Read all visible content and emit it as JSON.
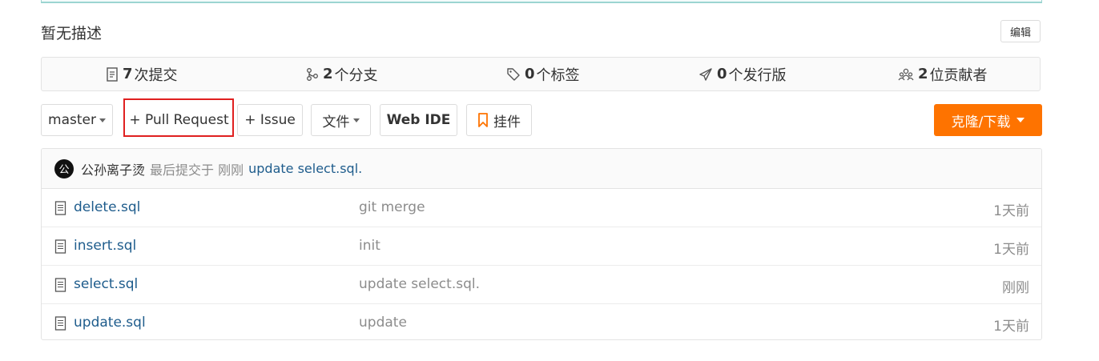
{
  "repo": {
    "description": "暂无描述",
    "edit_label": "编辑"
  },
  "stats": [
    {
      "count": "7",
      "label": "次提交",
      "icon": "commit-icon"
    },
    {
      "count": "2",
      "label": "个分支",
      "icon": "branch-icon"
    },
    {
      "count": "0",
      "label": "个标签",
      "icon": "tag-icon"
    },
    {
      "count": "0",
      "label": "个发行版",
      "icon": "release-icon"
    },
    {
      "count": "2",
      "label": "位贡献者",
      "icon": "contributors-icon"
    }
  ],
  "toolbar": {
    "branch": "master",
    "pull_request": "+ Pull Request",
    "issue": "+ Issue",
    "file_menu": "文件",
    "web_ide": "Web IDE",
    "widget": "挂件",
    "clone": "克隆/下载"
  },
  "colors": {
    "accent": "#fe7300",
    "link": "#1e5c8c",
    "highlight_frame": "#e02020",
    "widget_icon": "#fe7300"
  },
  "last_commit": {
    "avatar_letter": "公",
    "author": "公孙离子烫",
    "meta": "最后提交于 刚刚",
    "message": "update select.sql."
  },
  "files": [
    {
      "name": "delete.sql",
      "message": "git merge",
      "time": "1天前"
    },
    {
      "name": "insert.sql",
      "message": "init",
      "time": "1天前"
    },
    {
      "name": "select.sql",
      "message": "update select.sql.",
      "time": "刚刚"
    },
    {
      "name": "update.sql",
      "message": "update",
      "time": "1天前"
    }
  ]
}
